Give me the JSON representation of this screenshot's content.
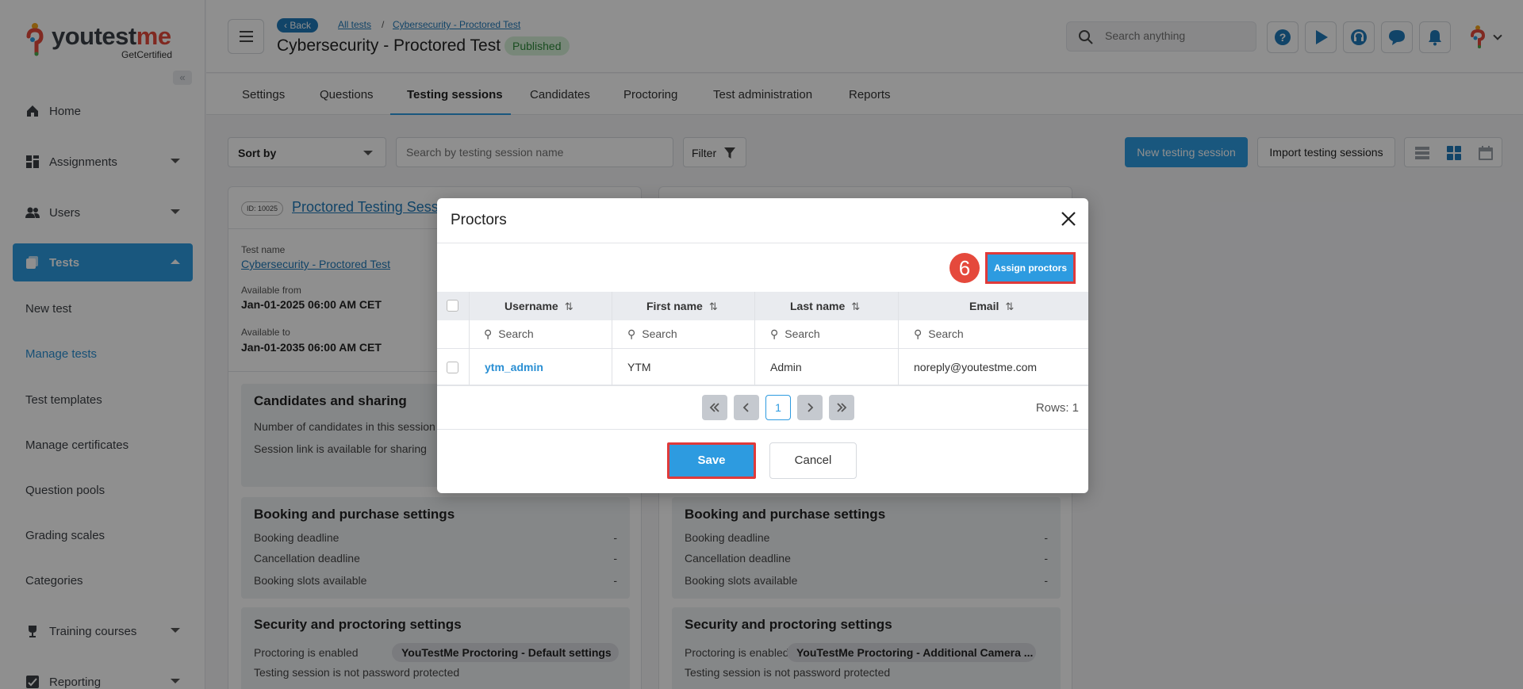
{
  "brand": {
    "name_main": "youtest",
    "name_accent": "me",
    "tagline": "GetCertified"
  },
  "sidebar": {
    "items": [
      {
        "label": "Home"
      },
      {
        "label": "Assignments"
      },
      {
        "label": "Users"
      },
      {
        "label": "Tests"
      }
    ],
    "sub_items": [
      {
        "label": "New test"
      },
      {
        "label": "Manage tests"
      },
      {
        "label": "Test templates"
      },
      {
        "label": "Manage certificates"
      },
      {
        "label": "Question pools"
      },
      {
        "label": "Grading scales"
      },
      {
        "label": "Categories"
      }
    ],
    "bottom_items": [
      {
        "label": "Training courses"
      },
      {
        "label": "Reporting"
      }
    ]
  },
  "header": {
    "back_label": "Back",
    "breadcrumb": [
      "All tests",
      "Cybersecurity - Proctored Test"
    ],
    "breadcrumb_sep": "/",
    "title": "Cybersecurity - Proctored Test",
    "status": "Published",
    "search_placeholder": "Search anything"
  },
  "tabs": [
    "Settings",
    "Questions",
    "Testing sessions",
    "Candidates",
    "Proctoring",
    "Test administration",
    "Reports"
  ],
  "toolbar": {
    "sort_label": "Sort by",
    "search_placeholder": "Search by testing session name",
    "filter_label": "Filter",
    "new_session_label": "New testing session",
    "import_label": "Import testing sessions"
  },
  "cards": [
    {
      "id_label": "ID: 10025",
      "title": "Proctored Testing Session",
      "test_name_label": "Test name",
      "test_name": "Cybersecurity - Proctored Test",
      "available_from_label": "Available from",
      "available_from": "Jan-01-2025 06:00 AM CET",
      "available_to_label": "Available to",
      "available_to": "Jan-01-2035 06:00 AM CET",
      "candidates_title": "Candidates and sharing",
      "candidates_rows": [
        "Number of candidates in this session",
        "Session link is available for sharing"
      ],
      "booking_title": "Booking and purchase settings",
      "booking_rows": [
        {
          "label": "Booking deadline",
          "value": "-"
        },
        {
          "label": "Cancellation deadline",
          "value": "-"
        },
        {
          "label": "Booking slots available",
          "value": "-"
        }
      ],
      "security_title": "Security and proctoring settings",
      "proctoring_label": "Proctoring is enabled",
      "proctoring_setting": "YouTestMe Proctoring - Default settings",
      "password_text": "Testing session is not password protected"
    },
    {
      "booking_title": "Booking and purchase settings",
      "booking_rows": [
        {
          "label": "Booking deadline",
          "value": "-"
        },
        {
          "label": "Cancellation deadline",
          "value": "-"
        },
        {
          "label": "Booking slots available",
          "value": "-"
        }
      ],
      "security_title": "Security and proctoring settings",
      "proctoring_label": "Proctoring is enabled",
      "proctoring_setting": "YouTestMe Proctoring - Additional Camera ...",
      "password_text": "Testing session is not password protected"
    }
  ],
  "modal": {
    "title": "Proctors",
    "step_number": "6",
    "assign_label": "Assign proctors",
    "columns": [
      "Username",
      "First name",
      "Last name",
      "Email"
    ],
    "filter_placeholder": "Search",
    "rows": [
      {
        "username": "ytm_admin",
        "first_name": "YTM",
        "last_name": "Admin",
        "email": "noreply@youtestme.com"
      }
    ],
    "current_page": "1",
    "rows_label": "Rows: 1",
    "save_label": "Save",
    "cancel_label": "Cancel"
  },
  "colors": {
    "accent": "#2d9be0",
    "highlight": "#e03a3a",
    "published": "#2e8a3a"
  }
}
